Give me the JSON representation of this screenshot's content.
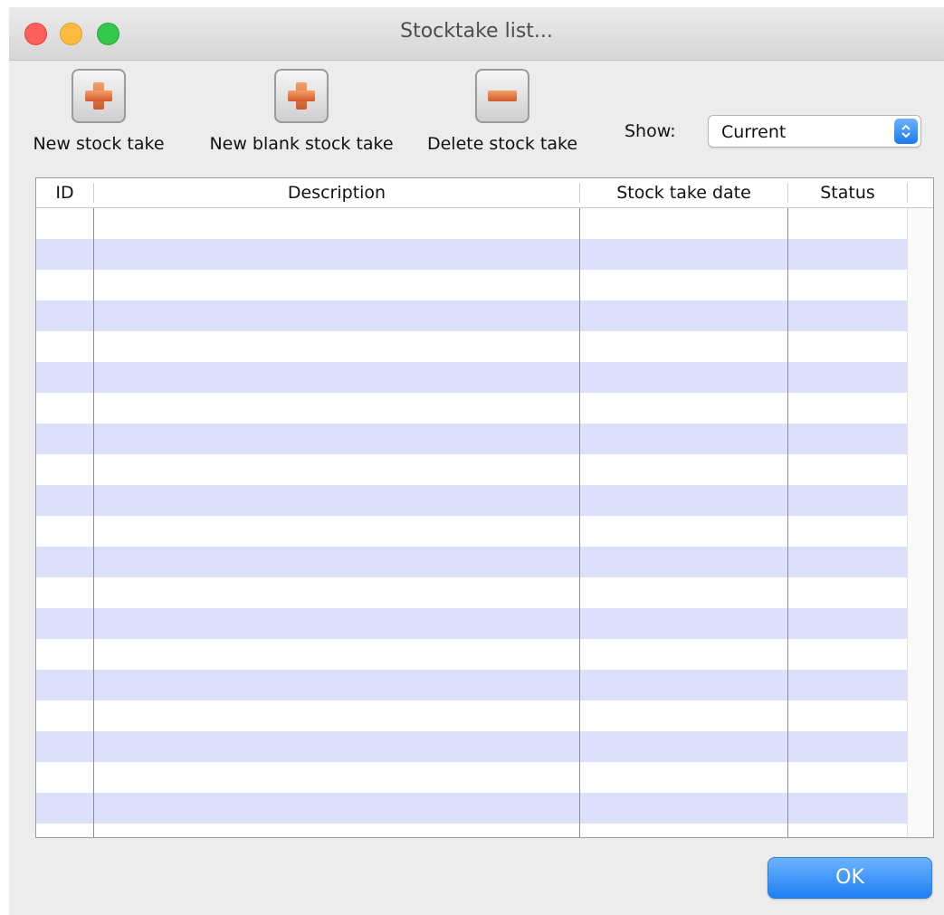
{
  "window": {
    "title": "Stocktake list..."
  },
  "toolbar": {
    "new_label": "New stock take",
    "new_blank_label": "New blank stock take",
    "delete_label": "Delete stock take"
  },
  "filter": {
    "label": "Show:",
    "selected": "Current"
  },
  "table": {
    "columns": [
      "ID",
      "Description",
      "Stock take date",
      "Status"
    ],
    "rows": []
  },
  "footer": {
    "ok_label": "OK"
  },
  "colors": {
    "row_stripe": "#dde0fb",
    "accent_blue": "#1f7ff2",
    "icon_orange": "#e4763c"
  },
  "icons": [
    "plus-icon",
    "minus-icon",
    "select-arrows-icon"
  ]
}
